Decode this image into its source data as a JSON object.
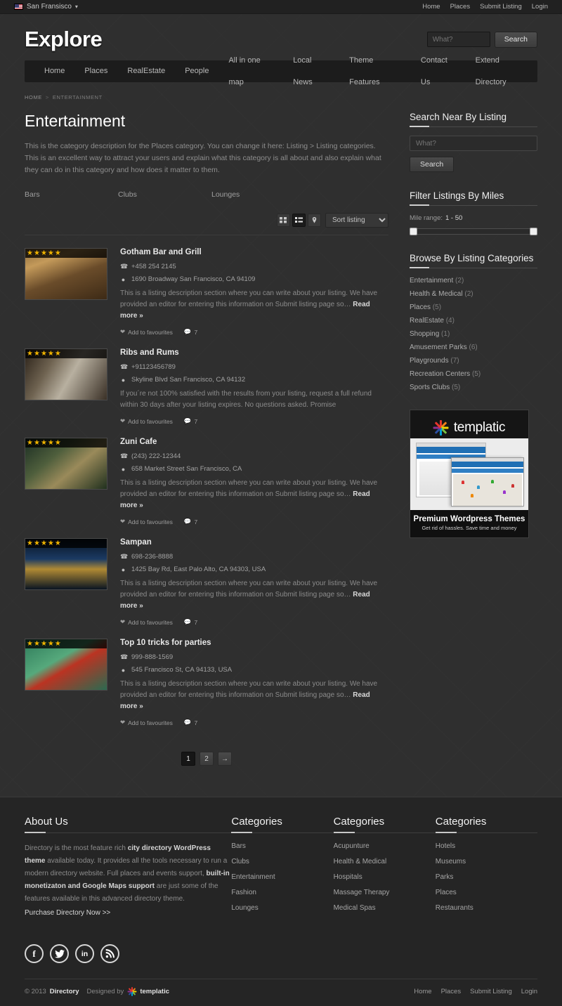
{
  "topbar": {
    "city": "San Fransisco",
    "flag_icon": "us-flag-icon",
    "nav": [
      "Home",
      "Places",
      "Submit Listing",
      "Login"
    ]
  },
  "header": {
    "logo": "Explore",
    "search_placeholder": "What?",
    "search_value": "",
    "search_button": "Search"
  },
  "mainnav": [
    "Home",
    "Places",
    "RealEstate",
    "People",
    "All in one map",
    "Local News",
    "Theme Features",
    "Contact Us",
    "Extend Directory"
  ],
  "breadcrumb": {
    "home": "HOME",
    "sep": ">",
    "current": "ENTERTAINMENT"
  },
  "page": {
    "title": "Entertainment",
    "description": "This is the category description for the Places category. You can change it here: Listing > Listing categories. This is an excellent way to attract your users and explain what this category is all about and also explain what they can do in this category and how does it matter to them.",
    "subcategories": [
      "Bars",
      "Clubs",
      "Lounges"
    ]
  },
  "toolbar": {
    "grid_icon": "grid-view-icon",
    "list_icon": "list-view-icon",
    "map_icon": "map-pin-icon",
    "sort_label": "Sort listing",
    "sort_options": [
      "Sort listing"
    ]
  },
  "listings": [
    {
      "title": "Gotham Bar and Grill",
      "phone": "+458 254 2145",
      "address": "1690 Broadway San Francisco, CA 94109",
      "description": "This is a listing description section where you can write about your listing. We have provided an editor for entering this information on Submit listing page so…",
      "read_more": "Read more »",
      "favourite": "Add to favourites",
      "comments": "7",
      "stars": 5
    },
    {
      "title": "Ribs and Rums",
      "phone": "+91123456789",
      "address": "Skyline Blvd San Francisco, CA 94132",
      "description": "If you´re not 100% satisfied with the results from your listing, request a full refund within 30 days after your listing expires. No questions asked. Promise",
      "read_more": "",
      "favourite": "Add to favourites",
      "comments": "7",
      "stars": 5
    },
    {
      "title": "Zuni Cafe",
      "phone": "(243) 222-12344",
      "address": "658 Market Street San Francisco, CA",
      "description": "This is a listing description section where you can write about your listing. We have provided an editor for entering this information on Submit listing page so…",
      "read_more": "Read more »",
      "favourite": "Add to favourites",
      "comments": "7",
      "stars": 5
    },
    {
      "title": "Sampan",
      "phone": "698-236-8888",
      "address": "1425 Bay Rd, East Palo Alto, CA 94303, USA",
      "description": "This is a listing description section where you can write about your listing. We have provided an editor for entering this information on Submit listing page so…",
      "read_more": "Read more »",
      "favourite": "Add to favourites",
      "comments": "7",
      "stars": 5
    },
    {
      "title": "Top 10 tricks for parties",
      "phone": "999-888-1569",
      "address": "545 Francisco St, CA 94133, USA",
      "description": "This is a listing description section where you can write about your listing. We have provided an editor for entering this information on Submit listing page so…",
      "read_more": "Read more »",
      "favourite": "Add to favourites",
      "comments": "7",
      "stars": 5
    }
  ],
  "pagination": {
    "pages": [
      "1",
      "2"
    ],
    "current": "1",
    "next_icon": "arrow-right-icon"
  },
  "sidebar": {
    "search_widget": {
      "title": "Search Near By Listing",
      "placeholder": "What?",
      "value": "",
      "button": "Search"
    },
    "miles_widget": {
      "title": "Filter Listings By Miles",
      "label": "Mile range:",
      "range": "1 - 50",
      "min": 1,
      "max": 50
    },
    "categories_widget": {
      "title": "Browse By Listing Categories",
      "items": [
        {
          "label": "Entertainment",
          "count": "(2)"
        },
        {
          "label": "Health & Medical",
          "count": "(2)"
        },
        {
          "label": "Places",
          "count": "(5)"
        },
        {
          "label": "RealEstate",
          "count": "(4)"
        },
        {
          "label": "Shopping",
          "count": "(1)"
        },
        {
          "label": "Amusement Parks",
          "count": "(6)"
        },
        {
          "label": "Playgrounds",
          "count": "(7)"
        },
        {
          "label": "Recreation Centers",
          "count": "(5)"
        },
        {
          "label": "Sports Clubs",
          "count": "(5)"
        }
      ]
    },
    "ad": {
      "brand": "templatic",
      "headline": "Premium Wordpress Themes",
      "subline": "Get rid of hassles. Save time and money"
    }
  },
  "footer": {
    "about": {
      "title": "About Us",
      "text_1": "Directory is the most feature rich ",
      "bold_1": "city directory WordPress theme",
      "text_2": " available today. It provides all the tools necessary to run a modern directory website. Full places and events support, ",
      "bold_2": "built-in monetizaton and Google Maps support",
      "text_3": " are just some of the features available in this advanced directory theme.",
      "purchase": "Purchase Directory Now >>"
    },
    "columns": [
      {
        "title": "Categories",
        "items": [
          "Bars",
          "Clubs",
          "Entertainment",
          "Fashion",
          "Lounges"
        ]
      },
      {
        "title": "Categories",
        "items": [
          "Acupunture",
          "Health & Medical",
          "Hospitals",
          "Massage Therapy",
          "Medical Spas"
        ]
      },
      {
        "title": "Categories",
        "items": [
          "Hotels",
          "Museums",
          "Parks",
          "Places",
          "Restaurants"
        ]
      }
    ],
    "social": [
      {
        "name": "facebook-icon",
        "glyph": "f"
      },
      {
        "name": "twitter-icon",
        "glyph": "🐦"
      },
      {
        "name": "linkedin-icon",
        "glyph": "in"
      },
      {
        "name": "rss-icon",
        "glyph": "●"
      }
    ],
    "copyright": "© 2013",
    "copyright_brand": "Directory",
    "designed_by": "Designed by",
    "designed_brand": "templatic",
    "bottom_nav": [
      "Home",
      "Places",
      "Submit Listing",
      "Login"
    ]
  },
  "colors": {
    "page_bg": "#2f2f2f",
    "topbar_bg": "#212121",
    "nav_bg": "#1c1c1c",
    "footer_bg": "#252525",
    "star": "#f0b400",
    "accent_text": "#ffffff"
  }
}
